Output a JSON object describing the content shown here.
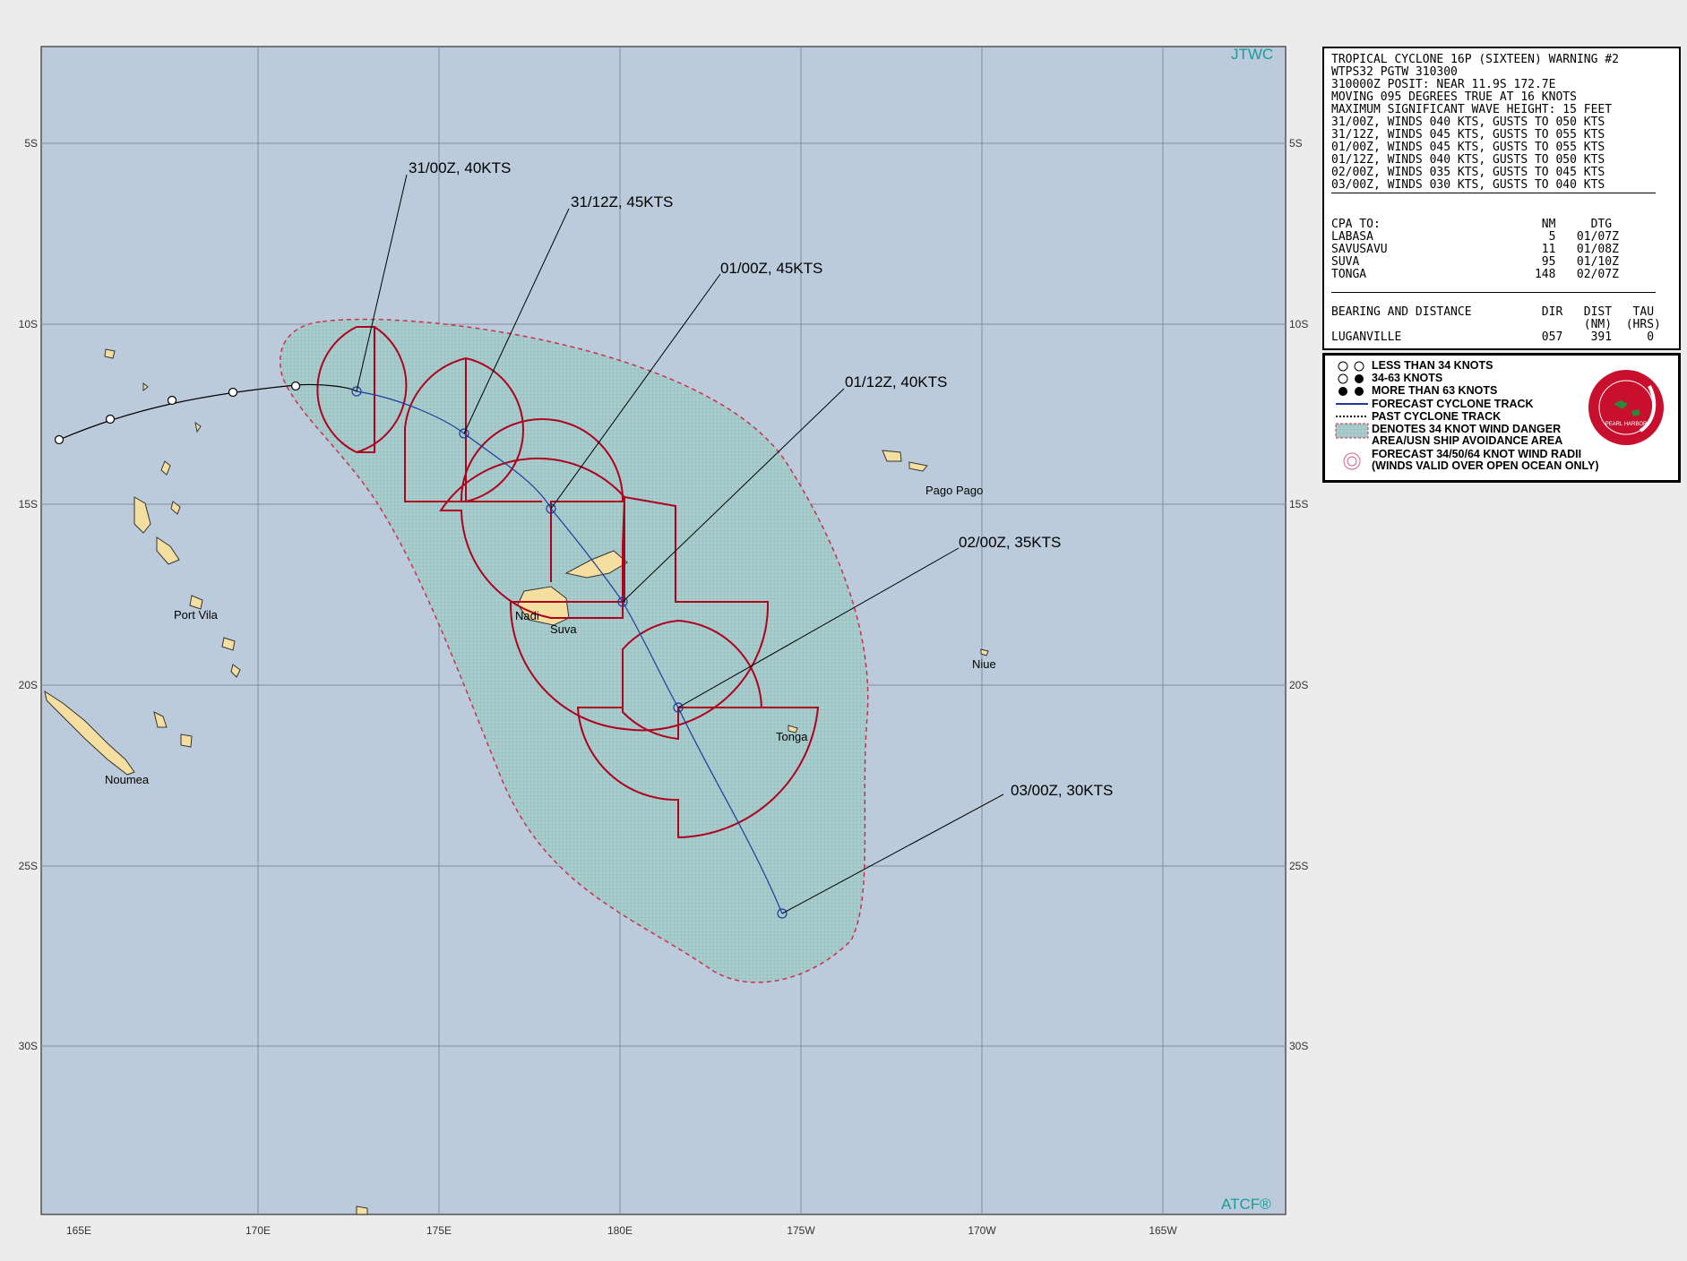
{
  "map": {
    "agency_top": "JTWC",
    "agency_bottom": "ATCF®",
    "lon_labels": [
      "165E",
      "170E",
      "175E",
      "180E",
      "175W",
      "170W",
      "165W"
    ],
    "lat_labels": [
      "5S",
      "10S",
      "15S",
      "20S",
      "25S",
      "30S"
    ],
    "places": [
      "Pago Pago",
      "Port Vila",
      "Nadi",
      "Suva",
      "Niue",
      "Tonga",
      "Noumea"
    ],
    "forecast_labels": [
      "31/00Z, 40KTS",
      "31/12Z, 45KTS",
      "01/00Z, 45KTS",
      "01/12Z, 40KTS",
      "02/00Z, 35KTS",
      "03/00Z, 30KTS"
    ],
    "colors": {
      "ocean": "#bccbdc",
      "land": "#f5dfa0",
      "danger_area": "#a9cccc",
      "radii": "#b0001e",
      "forecast_track": "#1f3a9a",
      "past_track": "#000000",
      "agency": "#1a9a9a"
    }
  },
  "warning": {
    "lines": [
      "TROPICAL CYCLONE 16P (SIXTEEN) WARNING #2",
      "WTPS32 PGTW 310300",
      "310000Z POSIT: NEAR 11.9S 172.7E",
      "MOVING 095 DEGREES TRUE AT 16 KNOTS",
      "MAXIMUM SIGNIFICANT WAVE HEIGHT: 15 FEET",
      "31/00Z, WINDS 040 KTS, GUSTS TO 050 KTS",
      "31/12Z, WINDS 045 KTS, GUSTS TO 055 KTS",
      "01/00Z, WINDS 045 KTS, GUSTS TO 055 KTS",
      "01/12Z, WINDS 040 KTS, GUSTS TO 050 KTS",
      "02/00Z, WINDS 035 KTS, GUSTS TO 045 KTS",
      "03/00Z, WINDS 030 KTS, GUSTS TO 040 KTS"
    ],
    "cpa_header": "CPA TO:                       NM     DTG",
    "cpa_rows": [
      "LABASA                         5   01/07Z",
      "SAVUSAVU                      11   01/08Z",
      "SUVA                          95   01/10Z",
      "TONGA                        148   02/07Z"
    ],
    "bearing_header": "BEARING AND DISTANCE          DIR   DIST   TAU",
    "bearing_units": "                                    (NM)  (HRS)",
    "bearing_row": "LUGANVILLE                    057    391     0"
  },
  "legend": {
    "items": [
      "LESS THAN 34 KNOTS",
      "34-63 KNOTS",
      "MORE THAN 63 KNOTS",
      "FORECAST CYCLONE TRACK",
      "PAST CYCLONE TRACK",
      "DENOTES 34 KNOT WIND DANGER\nAREA/USN SHIP AVOIDANCE AREA",
      "FORECAST 34/50/64 KNOT WIND RADII\n(WINDS VALID OVER OPEN OCEAN ONLY)"
    ],
    "emblem_text": "PEARL HARBOR"
  }
}
